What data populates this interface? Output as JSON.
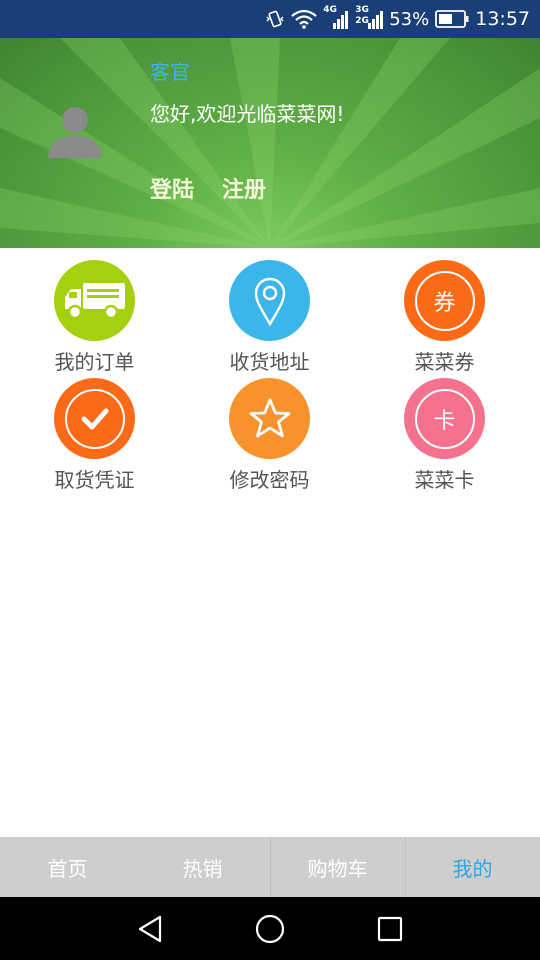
{
  "status_bar": {
    "network_4g": "4G",
    "network_3g": "3G",
    "network_2g": "2G",
    "battery_percent": "53%",
    "time": "13:57",
    "icons": [
      "vibrate-icon",
      "wifi-icon",
      "signal-icon",
      "battery-icon"
    ]
  },
  "header": {
    "guest_label": "客官",
    "welcome_text": "您好,欢迎光临菜菜网!",
    "login_label": "登陆",
    "register_label": "注册",
    "avatar_icon": "user-avatar-icon"
  },
  "menu": {
    "items": [
      {
        "label": "我的订单",
        "icon": "truck-icon",
        "color": "#a4d00f"
      },
      {
        "label": "收货地址",
        "icon": "location-pin-icon",
        "color": "#3ab6ea"
      },
      {
        "label": "菜菜券",
        "icon": "coupon-icon",
        "icon_text": "券",
        "color": "#fb6a16"
      },
      {
        "label": "取货凭证",
        "icon": "checkmark-icon",
        "color": "#fb6a16"
      },
      {
        "label": "修改密码",
        "icon": "star-icon",
        "color": "#f7922c"
      },
      {
        "label": "菜菜卡",
        "icon": "card-icon",
        "icon_text": "卡",
        "color": "#f5728e"
      }
    ]
  },
  "tabbar": {
    "tabs": [
      {
        "label": "首页",
        "active": false
      },
      {
        "label": "热销",
        "active": false
      },
      {
        "label": "购物车",
        "active": false
      },
      {
        "label": "我的",
        "active": true
      }
    ],
    "active_color": "#2aa7e6"
  },
  "nav_bar": {
    "icons": [
      "back-icon",
      "home-icon",
      "recents-icon"
    ]
  }
}
